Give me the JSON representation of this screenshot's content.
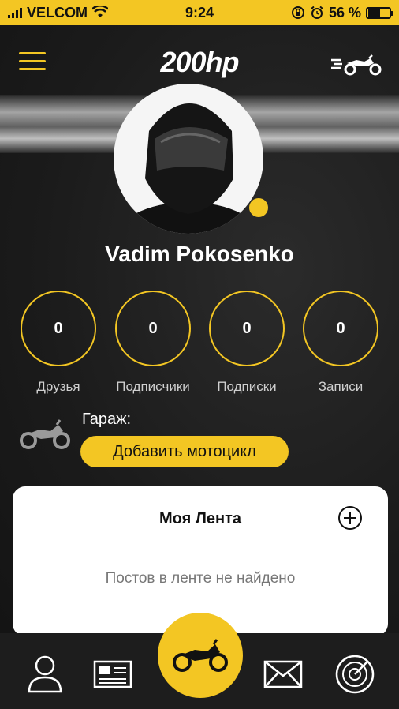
{
  "status_bar": {
    "carrier": "VELCOM",
    "time": "9:24",
    "battery_percent": "56 %",
    "battery_level": 0.56
  },
  "header": {
    "logo": "200hp",
    "menu_icon": "hamburger-menu-icon",
    "right_icon": "fast-motorcycle-icon"
  },
  "profile": {
    "name": "Vadim Pokosenko",
    "avatar_icon": "helmet-avatar",
    "online": true
  },
  "stats": [
    {
      "value": "0",
      "label": "Друзья"
    },
    {
      "value": "0",
      "label": "Подписчики"
    },
    {
      "value": "0",
      "label": "Подписки"
    },
    {
      "value": "0",
      "label": "Записи"
    }
  ],
  "garage": {
    "label": "Гараж:",
    "add_button": "Добавить мотоцикл",
    "icon": "motorcycle-icon"
  },
  "feed": {
    "title": "Моя Лента",
    "empty_text": "Постов в ленте не найдено",
    "add_icon": "plus-circle-icon"
  },
  "bottom_nav": {
    "items": [
      "profile-icon",
      "news-icon",
      "motorcycle-icon",
      "mail-icon",
      "radar-icon"
    ]
  },
  "colors": {
    "accent": "#f3c623",
    "background": "#1c1c1c",
    "card": "#ffffff"
  }
}
